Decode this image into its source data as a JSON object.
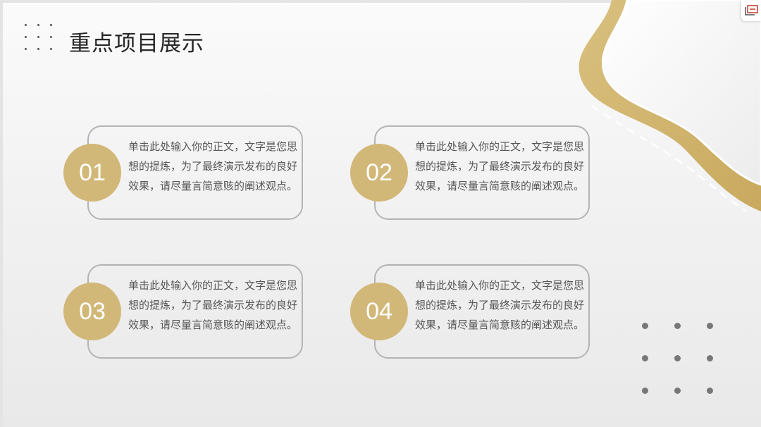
{
  "slide": {
    "title": "重点项目展示",
    "accent_color": "#d2b878"
  },
  "items": [
    {
      "number": "01",
      "text": "单击此处输入你的正文，文字是您思想的提炼，为了最终演示发布的良好效果，请尽量言简意赅的阐述观点。"
    },
    {
      "number": "02",
      "text": "单击此处输入你的正文，文字是您思想的提炼，为了最终演示发布的良好效果，请尽量言简意赅的阐述观点。"
    },
    {
      "number": "03",
      "text": "单击此处输入你的正文，文字是您思想的提炼，为了最终演示发布的良好效果，请尽量言简意赅的阐述观点。"
    },
    {
      "number": "04",
      "text": "单击此处输入你的正文，文字是您思想的提炼，为了最终演示发布的良好效果，请尽量言简意赅的阐述观点。"
    }
  ],
  "icons": {
    "corner": "slide-link-icon"
  }
}
